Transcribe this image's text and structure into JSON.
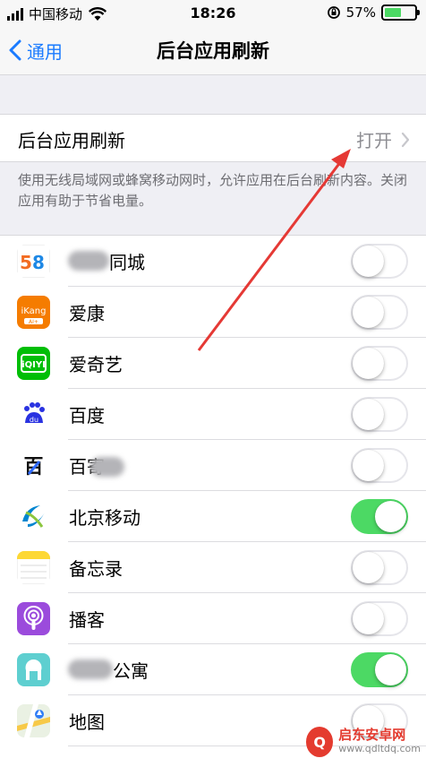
{
  "status_bar": {
    "carrier": "中国移动",
    "time": "18:26",
    "battery_percent": "57%",
    "battery_level": 0.57
  },
  "nav": {
    "back_label": "通用",
    "title": "后台应用刷新"
  },
  "setting": {
    "label": "后台应用刷新",
    "value": "打开"
  },
  "description": "使用无线局域网或蜂窝移动网时，允许应用在后台刷新内容。关闭应用有助于节省电量。",
  "apps": [
    {
      "name": "同城",
      "icon": "58-tongcheng-icon",
      "on": false
    },
    {
      "name": "爱康",
      "icon": "ikang-icon",
      "on": false
    },
    {
      "name": "爱奇艺",
      "icon": "iqiyi-icon",
      "on": false
    },
    {
      "name": "百度",
      "icon": "baidu-icon",
      "on": false
    },
    {
      "name": "百寄",
      "icon": "baijiahao-icon",
      "on": false
    },
    {
      "name": "北京移动",
      "icon": "china-mobile-icon",
      "on": true
    },
    {
      "name": "备忘录",
      "icon": "notes-icon",
      "on": false
    },
    {
      "name": "播客",
      "icon": "podcasts-icon",
      "on": false
    },
    {
      "name": "公寓",
      "icon": "apartment-icon",
      "on": true
    },
    {
      "name": "地图",
      "icon": "maps-icon",
      "on": false
    }
  ],
  "watermark": {
    "name": "启东安卓网",
    "url": "www.qdltdq.com"
  },
  "colors": {
    "accent": "#1a7bff",
    "toggle_on": "#4cd964",
    "annotation_arrow": "#e53935"
  }
}
